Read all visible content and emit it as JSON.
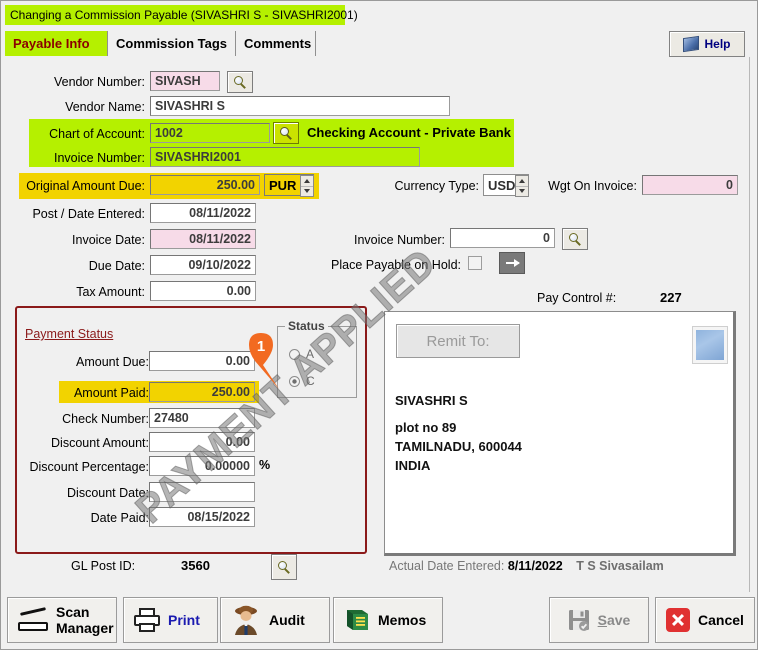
{
  "window": {
    "title": "Changing a Commission Payable  (SIVASHRI S - SIVASHRI2001)",
    "title_bg": "#b5f000"
  },
  "tabs": [
    {
      "label": "Payable Info",
      "active": true
    },
    {
      "label": "Commission Tags",
      "active": false
    },
    {
      "label": "Comments",
      "active": false
    }
  ],
  "help": {
    "label": "Help",
    "icon": "book-icon"
  },
  "form": {
    "vendor_number": {
      "label": "Vendor Number:",
      "value": "SIVASH"
    },
    "vendor_name": {
      "label": "Vendor Name:",
      "value": "SIVASHRI S"
    },
    "chart_of_account": {
      "label": "Chart of Account:",
      "value": "1002"
    },
    "account_desc_bold": "Checking Account",
    "account_desc_rest": " - Private Bank",
    "invoice_number_text": {
      "label": "Invoice Number:",
      "value": "SIVASHRI2001"
    },
    "original_amount_due": {
      "label": "Original Amount Due:",
      "value": "250.00"
    },
    "pur_selector": {
      "value": "PUR"
    },
    "currency_type": {
      "label": "Currency Type:",
      "value": "USD"
    },
    "wgt_on_invoice": {
      "label": "Wgt On Invoice:",
      "value": "0"
    },
    "post_date_entered": {
      "label": "Post / Date Entered:",
      "value": "08/11/2022"
    },
    "invoice_date": {
      "label": "Invoice Date:",
      "value": "08/11/2022"
    },
    "due_date": {
      "label": "Due Date:",
      "value": "09/10/2022"
    },
    "tax_amount": {
      "label": "Tax Amount:",
      "value": "0.00"
    },
    "invoice_number_num": {
      "label": "Invoice  Number:",
      "value": "0"
    },
    "place_payable_on_hold": {
      "label": "Place Payable on Hold:",
      "checked": false
    },
    "pay_control": {
      "label": "Pay Control #:",
      "value": "227"
    }
  },
  "payment_status": {
    "title": "Payment Status",
    "amount_due": {
      "label": "Amount Due:",
      "value": "0.00"
    },
    "amount_paid": {
      "label": "Amount Paid:",
      "value": "250.00"
    },
    "check_number": {
      "label": "Check Number:",
      "value": "27480"
    },
    "discount_amount": {
      "label": "Discount Amount:",
      "value": "0.00"
    },
    "discount_percentage": {
      "label": "Discount Percentage:",
      "value": "0.00000",
      "suffix": "%"
    },
    "discount_date": {
      "label": "Discount Date:",
      "value": ""
    },
    "date_paid": {
      "label": "Date Paid:",
      "value": "08/15/2022"
    },
    "status_group": {
      "legend": "Status",
      "options": [
        {
          "label": "A",
          "selected": false
        },
        {
          "label": "C",
          "selected": true
        }
      ]
    }
  },
  "remit": {
    "button_label": "Remit To:",
    "address": {
      "name": "SIVASHRI S",
      "line1": "plot no 89",
      "line2": "TAMILNADU,  600044",
      "line3": "INDIA"
    },
    "thumbnail_icon": "document-thumbnail-icon"
  },
  "footer": {
    "gl_post_label": "GL Post  ID:",
    "gl_post_value": "3560",
    "actual_date_label": "Actual Date Entered:",
    "actual_date_value": "8/11/2022",
    "user": "T S Sivasailam"
  },
  "toolbar": {
    "scan_manager_line1": "Scan",
    "scan_manager_line2": "Manager",
    "print": "Print",
    "audit": "Audit",
    "memos": "Memos",
    "save": "Save",
    "cancel": "Cancel"
  },
  "annotations": {
    "watermark": "PAYMENT APPLIED",
    "callout_number": "1",
    "callout_color": "#f26a21"
  }
}
